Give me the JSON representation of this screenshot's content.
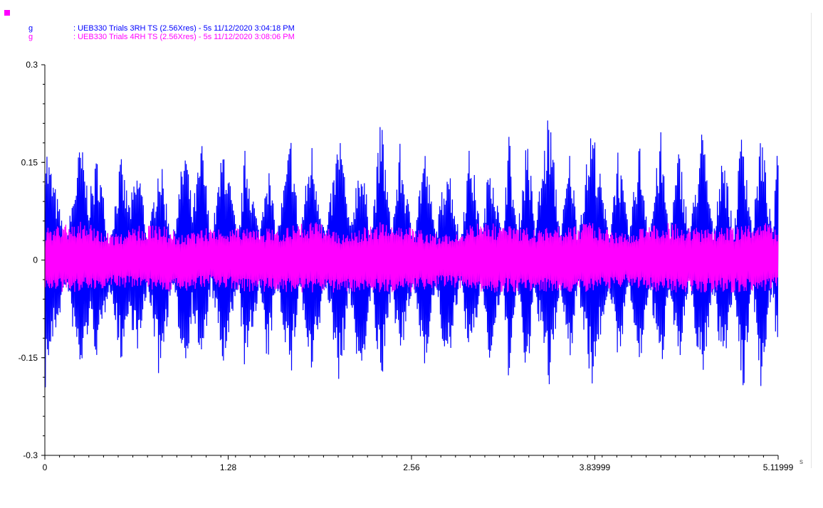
{
  "legend": {
    "marker_color": "#ff00ff",
    "entries": [
      {
        "unit": "g",
        "text": ": UEB330 Trials 3RH TS (2.56Xres) - 5s 11/12/2020 3:04:18 PM",
        "color": "#0000ff"
      },
      {
        "unit": "g",
        "text": ": UEB330 Trials 4RH TS (2.56Xres) - 5s 11/12/2020 3:08:06 PM",
        "color": "#ff00ff"
      }
    ]
  },
  "chart_data": {
    "type": "line",
    "x_unit": "s",
    "xlim": [
      0,
      5.11999
    ],
    "ylim": [
      -0.3,
      0.3
    ],
    "x_ticks": [
      "0",
      "1.28",
      "2.56",
      "3.83999",
      "5.11999"
    ],
    "x_tick_values": [
      0,
      1.28,
      2.56,
      3.83999,
      5.11999
    ],
    "y_ticks": [
      "0.3",
      "0.15",
      "0",
      "-0.15",
      "-0.3"
    ],
    "y_tick_values": [
      0.3,
      0.15,
      0,
      -0.15,
      -0.3
    ],
    "grid": false,
    "series": [
      {
        "name": "UEB330 Trials 3RH TS (2.56Xres) - 5s 11/12/2020 3:04:18 PM",
        "color": "#0000ff",
        "envelope": {
          "x": [
            0,
            0.02,
            0.15,
            0.25,
            0.31,
            0.37,
            0.45,
            0.53,
            0.59,
            0.66,
            0.72,
            0.8,
            0.89,
            0.98,
            1.03,
            1.1,
            1.16,
            1.25,
            1.35,
            1.4,
            1.5,
            1.55,
            1.62,
            1.72,
            1.78,
            1.86,
            1.96,
            2.06,
            2.13,
            2.2,
            2.28,
            2.35,
            2.42,
            2.48,
            2.57,
            2.65,
            2.73,
            2.81,
            2.9,
            2.97,
            3.05,
            3.11,
            3.19,
            3.24,
            3.3,
            3.37,
            3.42,
            3.52,
            3.6,
            3.67,
            3.72,
            3.82,
            3.94,
            4.0,
            4.08,
            4.15,
            4.22,
            4.3,
            4.36,
            4.43,
            4.5,
            4.59,
            4.67,
            4.73,
            4.81,
            4.87,
            4.94,
            5.0,
            5.08,
            5.12
          ],
          "max": [
            0.21,
            0.17,
            0.03,
            0.19,
            0.1,
            0.17,
            0.03,
            0.16,
            0.09,
            0.15,
            0.03,
            0.17,
            0.03,
            0.19,
            0.08,
            0.19,
            0.03,
            0.19,
            0.03,
            0.18,
            0.04,
            0.17,
            0.04,
            0.2,
            0.04,
            0.19,
            0.04,
            0.21,
            0.05,
            0.17,
            0.05,
            0.23,
            0.04,
            0.18,
            0.04,
            0.18,
            0.04,
            0.17,
            0.03,
            0.19,
            0.03,
            0.18,
            0.04,
            0.2,
            0.04,
            0.21,
            0.05,
            0.24,
            0.04,
            0.18,
            0.04,
            0.22,
            0.04,
            0.18,
            0.04,
            0.19,
            0.04,
            0.2,
            0.04,
            0.18,
            0.04,
            0.21,
            0.04,
            0.19,
            0.04,
            0.23,
            0.04,
            0.21,
            0.04,
            0.19
          ],
          "min": [
            -0.21,
            -0.17,
            -0.04,
            -0.19,
            -0.1,
            -0.16,
            -0.04,
            -0.16,
            -0.09,
            -0.15,
            -0.04,
            -0.19,
            -0.04,
            -0.18,
            -0.08,
            -0.18,
            -0.04,
            -0.18,
            -0.04,
            -0.19,
            -0.04,
            -0.18,
            -0.04,
            -0.19,
            -0.04,
            -0.2,
            -0.04,
            -0.2,
            -0.05,
            -0.21,
            -0.05,
            -0.22,
            -0.04,
            -0.17,
            -0.04,
            -0.17,
            -0.04,
            -0.19,
            -0.03,
            -0.18,
            -0.03,
            -0.18,
            -0.04,
            -0.19,
            -0.04,
            -0.21,
            -0.05,
            -0.21,
            -0.04,
            -0.17,
            -0.04,
            -0.2,
            -0.04,
            -0.17,
            -0.04,
            -0.19,
            -0.04,
            -0.19,
            -0.04,
            -0.17,
            -0.04,
            -0.2,
            -0.04,
            -0.19,
            -0.04,
            -0.23,
            -0.04,
            -0.2,
            -0.04,
            -0.17
          ]
        }
      },
      {
        "name": "UEB330 Trials 4RH TS (2.56Xres) - 5s 11/12/2020 3:08:06 PM",
        "color": "#ff00ff",
        "envelope": {
          "x": [
            0,
            0.25,
            0.5,
            0.75,
            0.95,
            1.15,
            1.4,
            1.65,
            1.9,
            2.1,
            2.35,
            2.56,
            2.8,
            3.05,
            3.3,
            3.55,
            3.8,
            4.05,
            4.3,
            4.55,
            4.8,
            5.0,
            5.12
          ],
          "max": [
            0.05,
            0.06,
            0.04,
            0.06,
            0.04,
            0.05,
            0.05,
            0.05,
            0.06,
            0.04,
            0.06,
            0.05,
            0.04,
            0.06,
            0.05,
            0.05,
            0.06,
            0.04,
            0.06,
            0.05,
            0.05,
            0.06,
            0.05
          ],
          "min": [
            -0.05,
            -0.05,
            -0.04,
            -0.05,
            -0.05,
            -0.04,
            -0.05,
            -0.05,
            -0.05,
            -0.05,
            -0.05,
            -0.05,
            -0.04,
            -0.05,
            -0.05,
            -0.05,
            -0.05,
            -0.04,
            -0.05,
            -0.05,
            -0.05,
            -0.05,
            -0.04
          ]
        }
      }
    ]
  }
}
